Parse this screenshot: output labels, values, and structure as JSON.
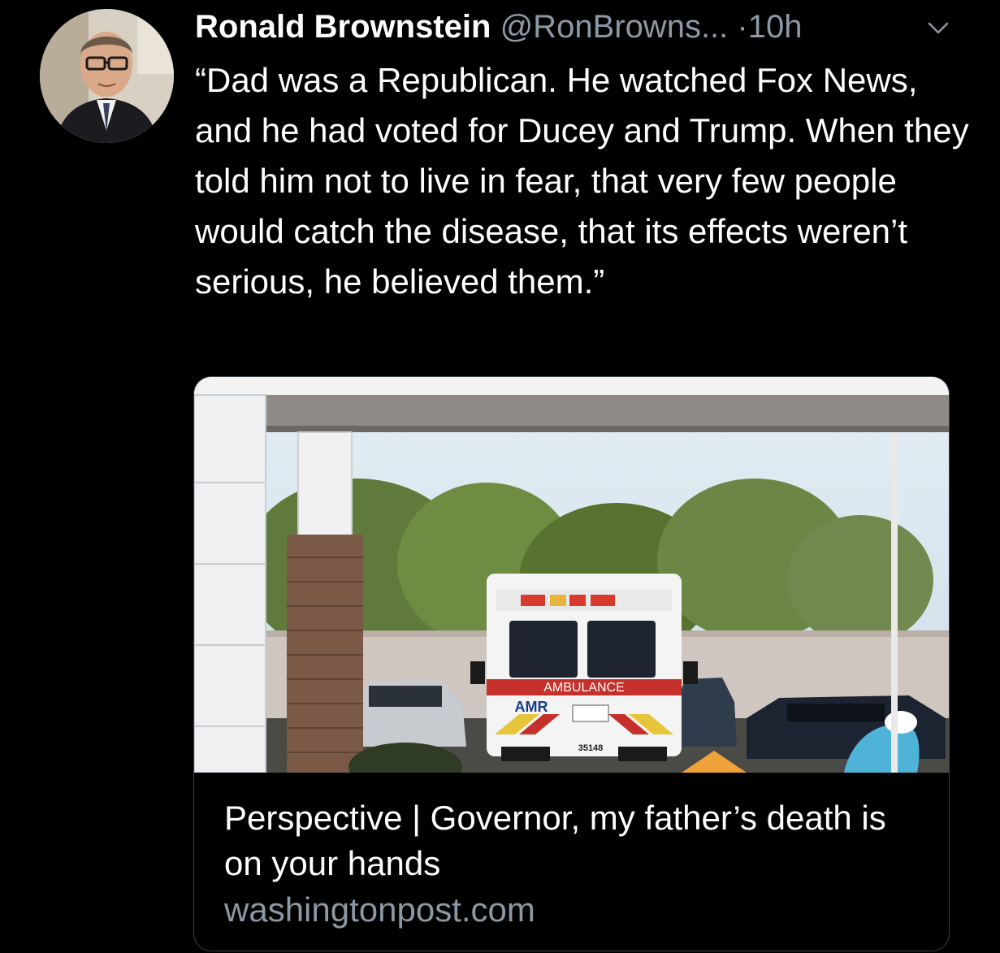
{
  "tweet": {
    "author_name": "Ronald Brownstein",
    "handle": "@RonBrowns...",
    "separator": "·",
    "time": "10h",
    "text": "“Dad was a Republican. He watched Fox News, and he had voted for Ducey and Trump. When they told him not to live in fear, that very few people would catch the disease, that its effects weren’t serious, he believed them.”"
  },
  "card": {
    "title": "Perspective | Governor, my father’s death is on your hands",
    "domain": "washingtonpost.com",
    "image": {
      "ambulance_label": "AMBULANCE",
      "ambulance_logo": "AMR",
      "ambulance_number": "35148"
    }
  },
  "icons": {
    "menu": "chevron-down-icon"
  },
  "colors": {
    "background": "#000000",
    "secondary_text": "#8b98a5",
    "card_border": "#38444d"
  }
}
